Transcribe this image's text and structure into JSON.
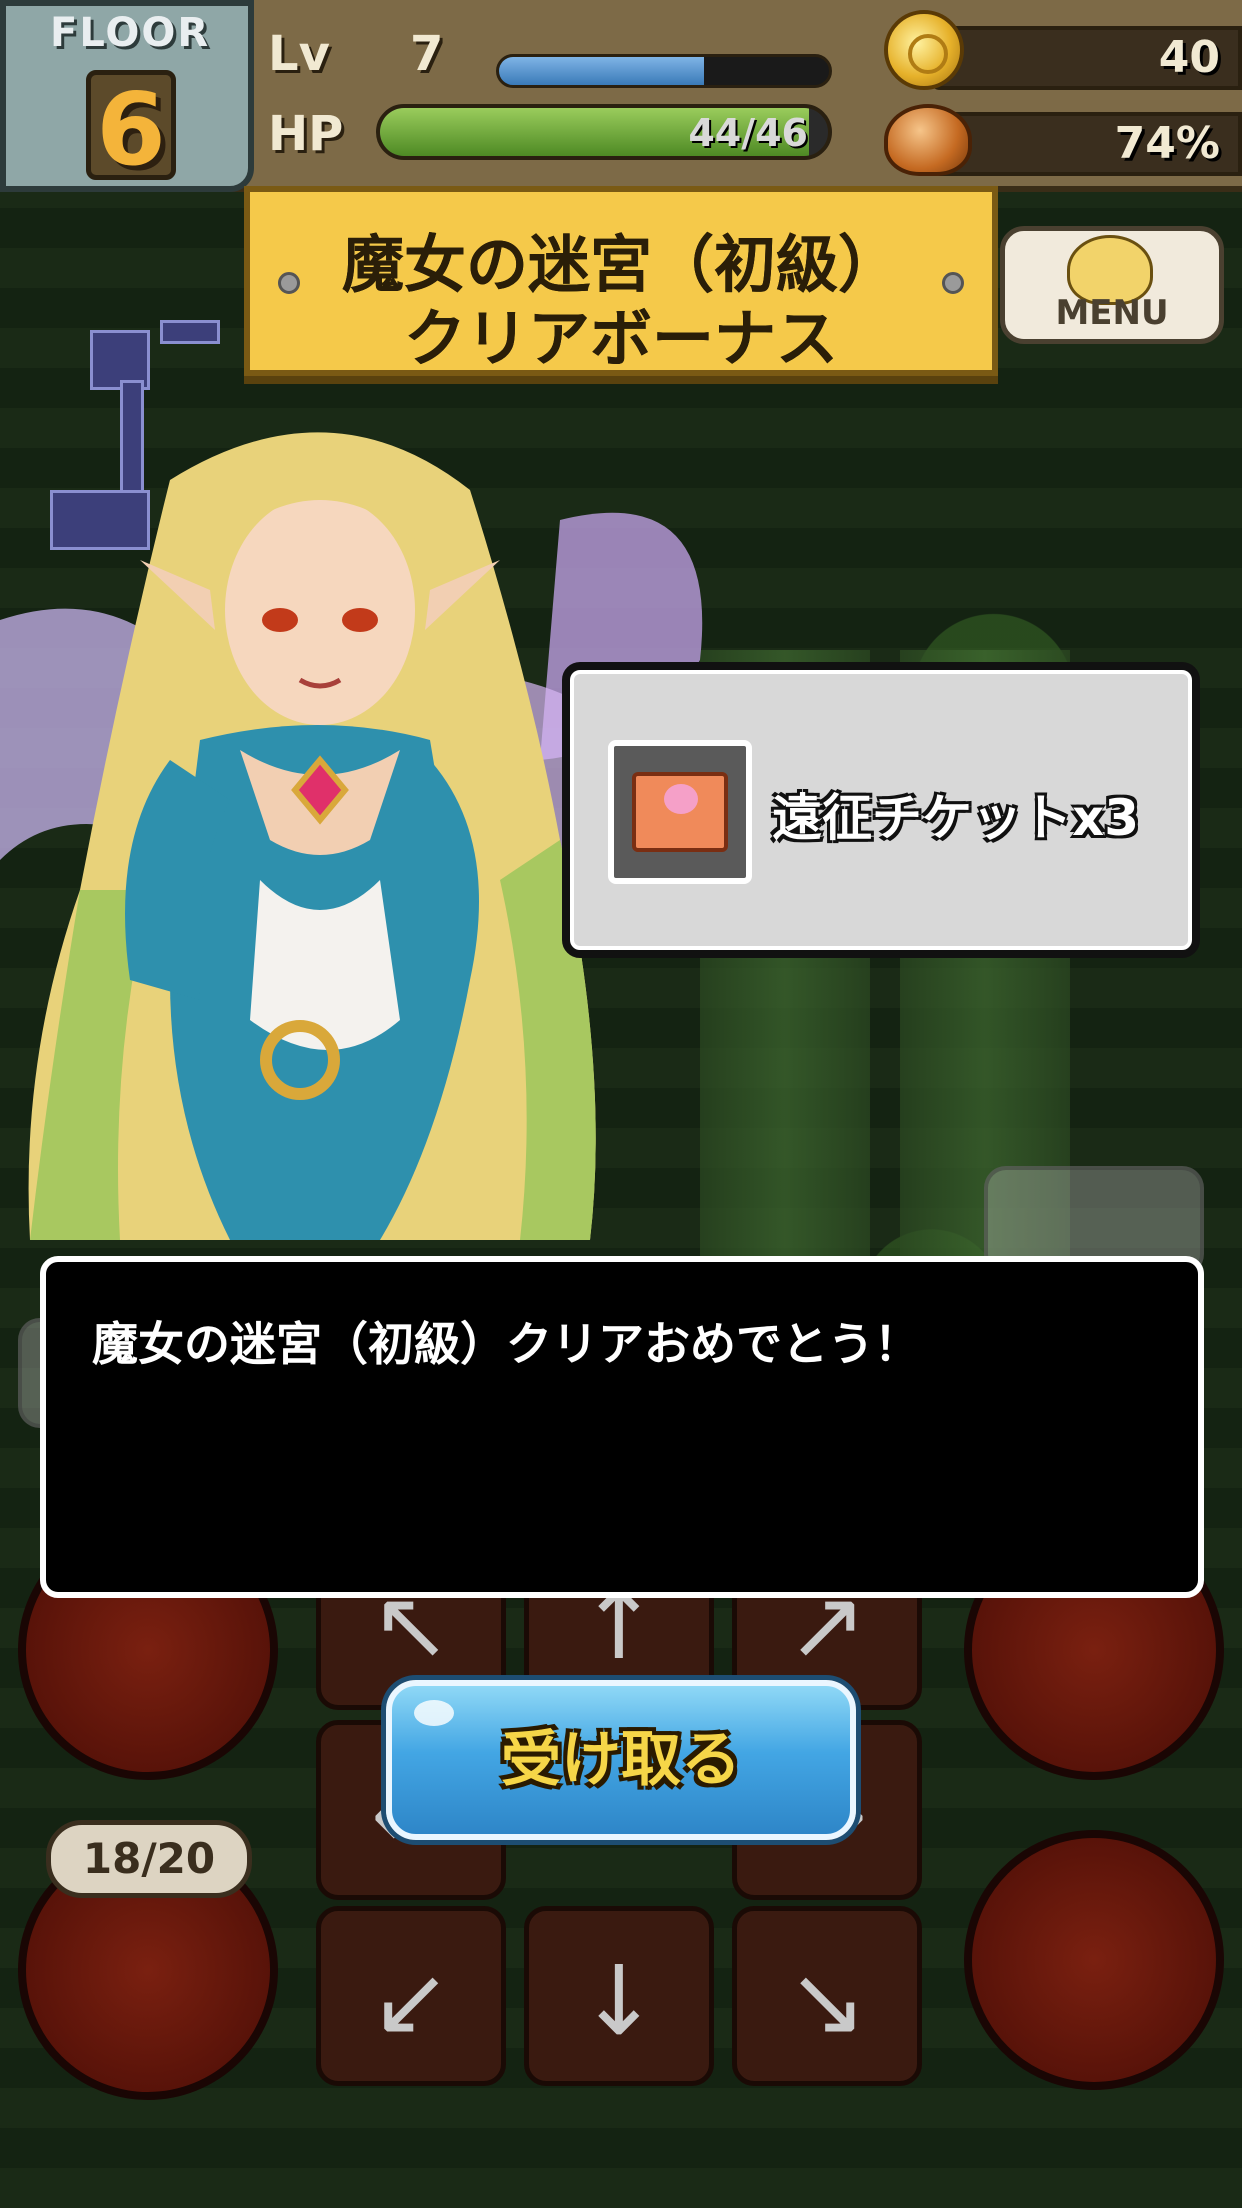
{
  "hud": {
    "floor_label": "FLOOR",
    "floor_number": "6",
    "level_label": "Lv",
    "level_value": "7",
    "xp_fraction": 0.62,
    "hp_label": "HP",
    "hp_text": "44/46",
    "hp_fraction": 0.9565,
    "coins": "40",
    "food_percent": "74%"
  },
  "banner": {
    "line1": "魔女の迷宮（初級）",
    "line2": "クリアボーナス"
  },
  "menu": {
    "label": "MENU"
  },
  "reward": {
    "item_text": "遠征チケットx3",
    "icon": "ticket-icon"
  },
  "message": {
    "text": "魔女の迷宮（初級）クリアおめでとう！"
  },
  "inventory": {
    "count": "18/20"
  },
  "receive_button": {
    "label": "受け取る"
  },
  "colors": {
    "banner": "#f5c94a",
    "button": "#43a6e4",
    "button_text": "#f6d648",
    "hp_bar": "#6aa83a",
    "xp_bar": "#3a7ab8"
  }
}
